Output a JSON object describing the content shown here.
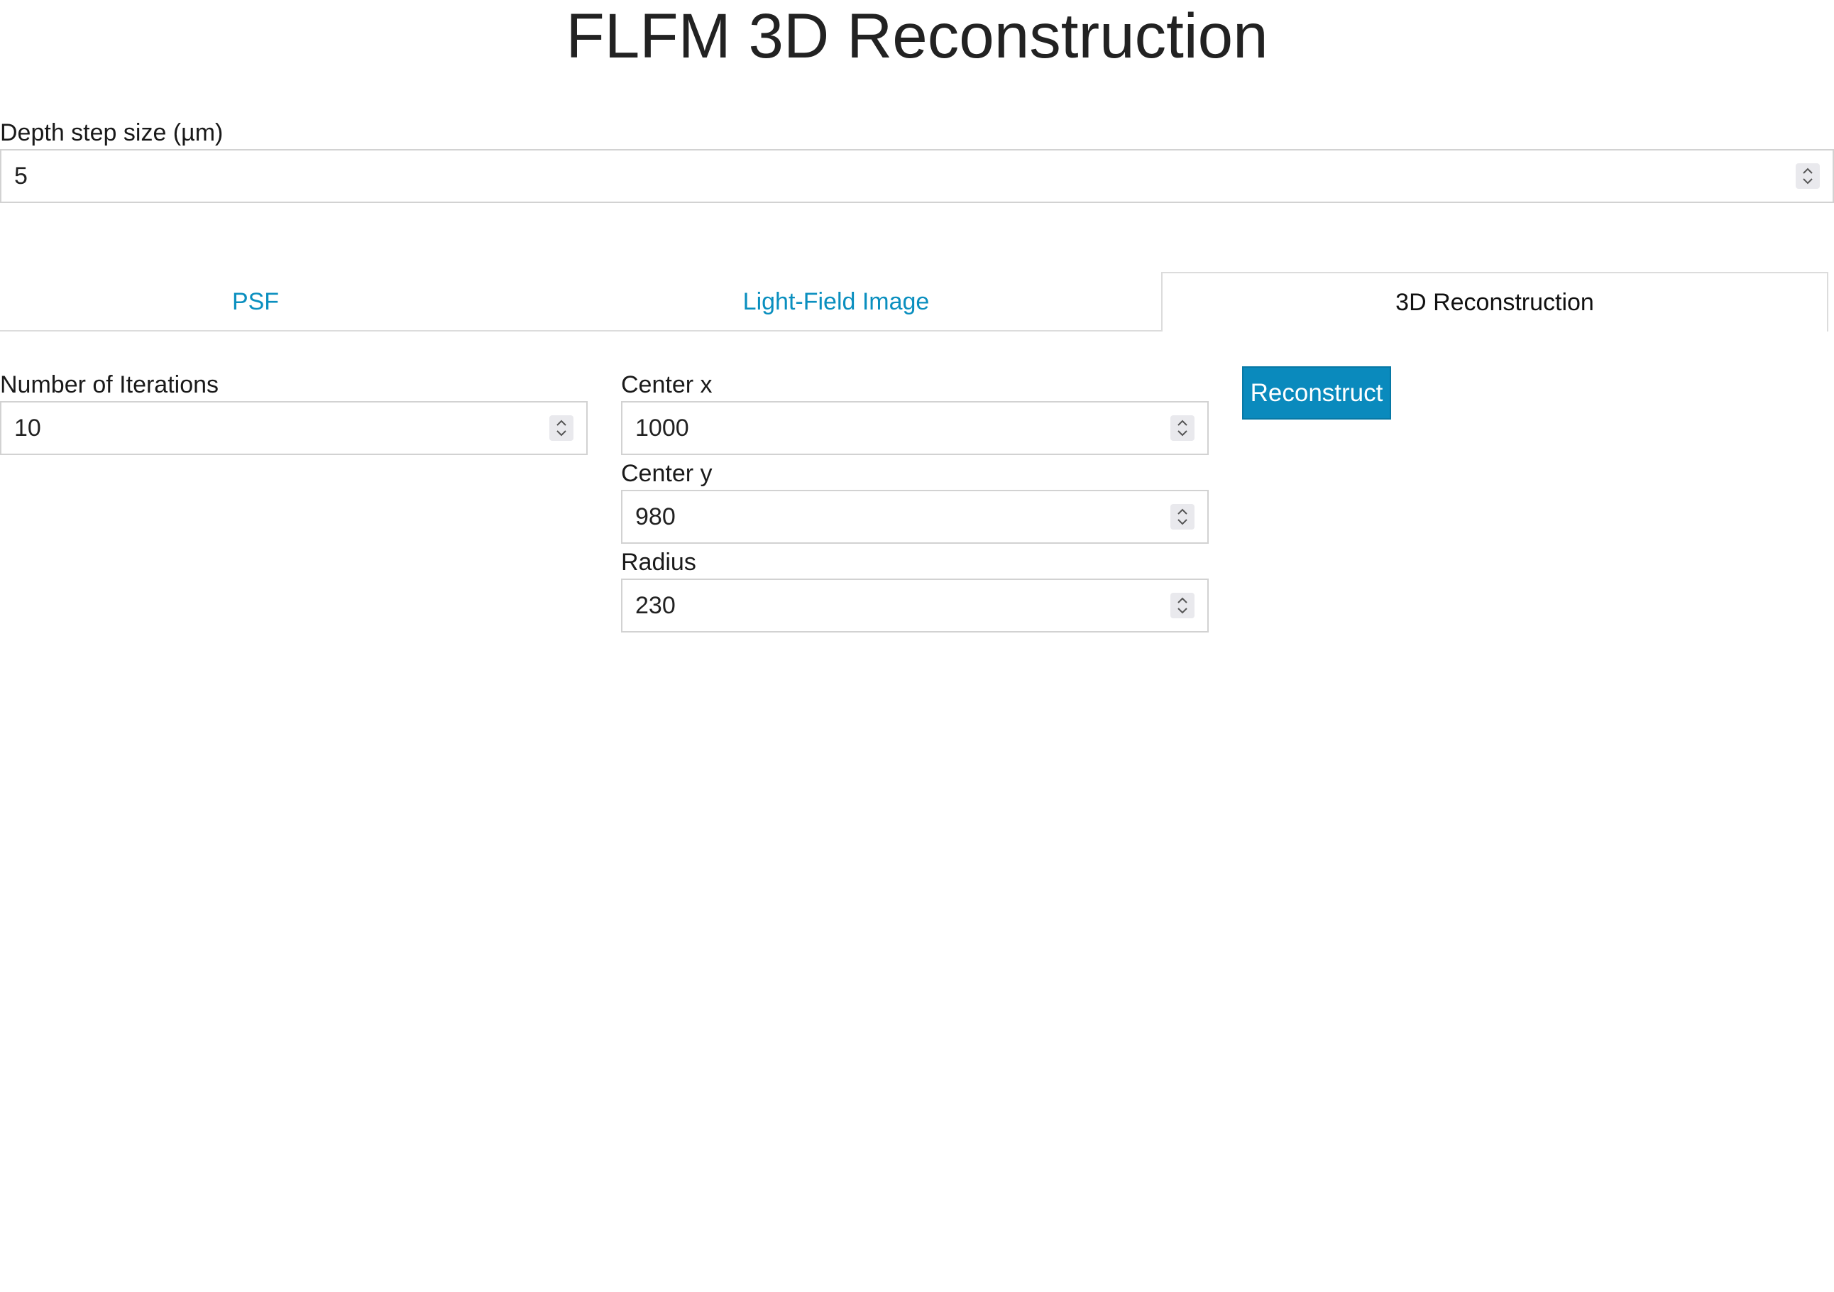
{
  "page": {
    "title": "FLFM 3D Reconstruction"
  },
  "depth_step": {
    "label": "Depth step size (µm)",
    "value": "5"
  },
  "tabs": [
    {
      "label": "PSF",
      "active": false
    },
    {
      "label": "Light-Field Image",
      "active": false
    },
    {
      "label": "3D Reconstruction",
      "active": true
    }
  ],
  "reconstruction": {
    "iterations": {
      "label": "Number of Iterations",
      "value": "10"
    },
    "center_x": {
      "label": "Center x",
      "value": "1000"
    },
    "center_y": {
      "label": "Center y",
      "value": "980"
    },
    "radius": {
      "label": "Radius",
      "value": "230"
    },
    "reconstruct_button": "Reconstruct"
  },
  "colors": {
    "accent": "#0a8abd",
    "tab_link": "#0a8fbf",
    "border": "#d2d2d2"
  },
  "icons": {
    "spinner": "up-down-chevron-icon"
  }
}
